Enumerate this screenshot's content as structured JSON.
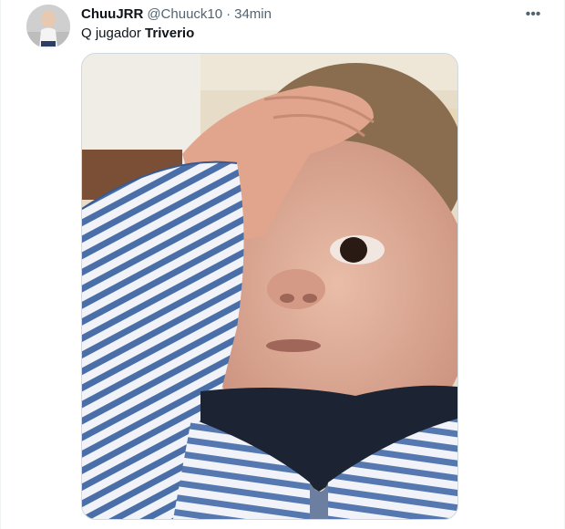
{
  "tweet": {
    "display_name": "ChuuJRR",
    "handle": "@Chuuck10",
    "separator": "·",
    "time": "34min",
    "text_prefix": "Q jugador ",
    "text_bold": "Triverio",
    "more_icon": "more-horizontal-icon"
  },
  "colors": {
    "secondary_text": "#536471",
    "border": "#cfd9de",
    "stripe_blue": "#4a6fa8"
  }
}
